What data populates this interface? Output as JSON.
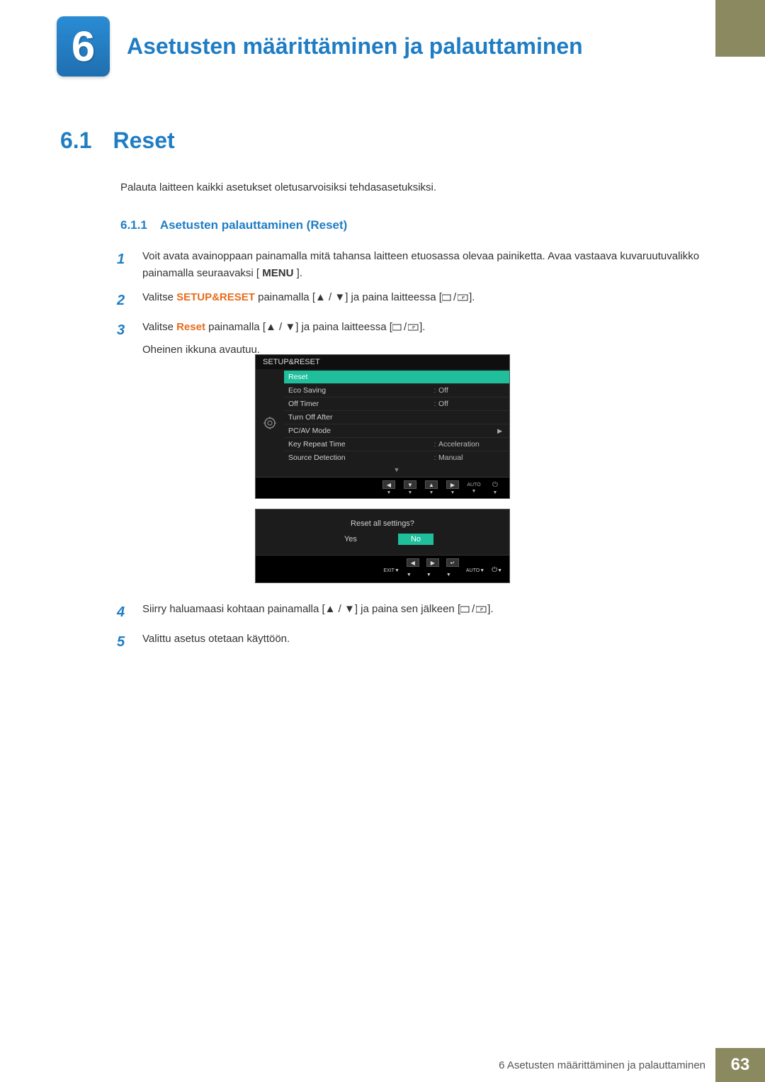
{
  "chapter": {
    "number": "6",
    "title": "Asetusten määrittäminen ja palauttaminen"
  },
  "section": {
    "number": "6.1",
    "title": "Reset"
  },
  "intro": "Palauta laitteen kaikki asetukset oletusarvoisiksi tehdasasetuksiksi.",
  "subsection": {
    "number": "6.1.1",
    "title": "Asetusten palauttaminen (Reset)"
  },
  "steps": {
    "s1": {
      "num": "1",
      "text_a": "Voit avata avainoppaan painamalla mitä tahansa laitteen etuosassa olevaa painiketta. Avaa vastaava kuvaruutuvalikko painamalla seuraavaksi [",
      "menu_label": "MENU",
      "text_b": "]."
    },
    "s2": {
      "num": "2",
      "pre": "Valitse ",
      "highlight": "SETUP&RESET",
      "mid": " painamalla [",
      "mid2": "] ja paina laitteessa [",
      "end": "]."
    },
    "s3": {
      "num": "3",
      "pre": "Valitse ",
      "highlight": "Reset",
      "mid": " painamalla [",
      "mid2": "] ja paina laitteessa [",
      "end": "].",
      "extra": "Oheinen ikkuna avautuu."
    },
    "s4": {
      "num": "4",
      "pre": "Siirry haluamaasi kohtaan painamalla [",
      "mid": "] ja paina sen jälkeen [",
      "end": "]."
    },
    "s5": {
      "num": "5",
      "text": "Valittu asetus otetaan käyttöön."
    }
  },
  "osd": {
    "title": "SETUP&RESET",
    "rows": [
      {
        "label": "Reset",
        "val": "",
        "selected": true,
        "sep": ""
      },
      {
        "label": "Eco Saving",
        "val": "Off",
        "selected": false,
        "sep": ":"
      },
      {
        "label": "Off Timer",
        "val": "Off",
        "selected": false,
        "sep": ":"
      },
      {
        "label": "Turn Off After",
        "val": "",
        "selected": false,
        "sep": ""
      },
      {
        "label": "PC/AV Mode",
        "val": "",
        "selected": false,
        "sep": "",
        "arrow": true
      },
      {
        "label": "Key Repeat Time",
        "val": "Acceleration",
        "selected": false,
        "sep": ":"
      },
      {
        "label": "Source Detection",
        "val": "Manual",
        "selected": false,
        "sep": ":"
      }
    ],
    "nav": {
      "auto": "AUTO"
    }
  },
  "osd2": {
    "question": "Reset all settings?",
    "yes": "Yes",
    "no": "No",
    "exit": "EXIT",
    "auto": "AUTO"
  },
  "footer": {
    "text": "6 Asetusten määrittäminen ja palauttaminen",
    "page": "63"
  }
}
